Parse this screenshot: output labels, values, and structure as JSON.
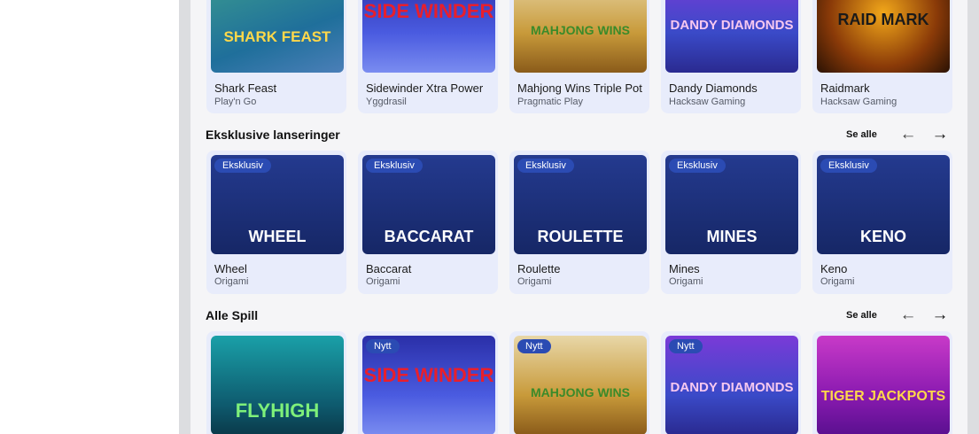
{
  "sections": {
    "top": {
      "cards": [
        {
          "title": "Shark Feast",
          "provider": "Play'n Go",
          "art": "SHARK FEAST"
        },
        {
          "title": "Sidewinder Xtra Power",
          "provider": "Yggdrasil",
          "art": "SIDE WINDER"
        },
        {
          "title": "Mahjong Wins Triple Pot",
          "provider": "Pragmatic Play",
          "art": "MAHJONG WINS"
        },
        {
          "title": "Dandy Diamonds",
          "provider": "Hacksaw Gaming",
          "art": "DANDY DIAMONDS"
        },
        {
          "title": "Raidmark",
          "provider": "Hacksaw Gaming",
          "art": "RAID MARK"
        }
      ]
    },
    "exclusive": {
      "heading": "Eksklusive lanseringer",
      "see_all": "Se alle",
      "cards": [
        {
          "title": "Wheel",
          "provider": "Origami",
          "badge": "Eksklusiv",
          "art": "WHEEL"
        },
        {
          "title": "Baccarat",
          "provider": "Origami",
          "badge": "Eksklusiv",
          "art": "BACCARAT"
        },
        {
          "title": "Roulette",
          "provider": "Origami",
          "badge": "Eksklusiv",
          "art": "ROULETTE"
        },
        {
          "title": "Mines",
          "provider": "Origami",
          "badge": "Eksklusiv",
          "art": "MINES"
        },
        {
          "title": "Keno",
          "provider": "Origami",
          "badge": "Eksklusiv",
          "art": "KENO"
        }
      ]
    },
    "all": {
      "heading": "Alle Spill",
      "see_all": "Se alle",
      "cards": [
        {
          "badge": "",
          "art": "FLYHIGH"
        },
        {
          "badge": "Nytt",
          "art": "SIDE WINDER"
        },
        {
          "badge": "Nytt",
          "art": "MAHJONG WINS"
        },
        {
          "badge": "Nytt",
          "art": "DANDY DIAMONDS"
        },
        {
          "badge": "",
          "art": "TIGER JACKPOTS"
        }
      ]
    }
  },
  "icons": {
    "prev": "arrow-left-icon",
    "next": "arrow-right-icon"
  },
  "colors": {
    "card_bg": "#e8ecfb",
    "badge": "#2b4bb3",
    "main_bg": "#f5f5f7",
    "exclusive_art": "#1c2a6b"
  }
}
